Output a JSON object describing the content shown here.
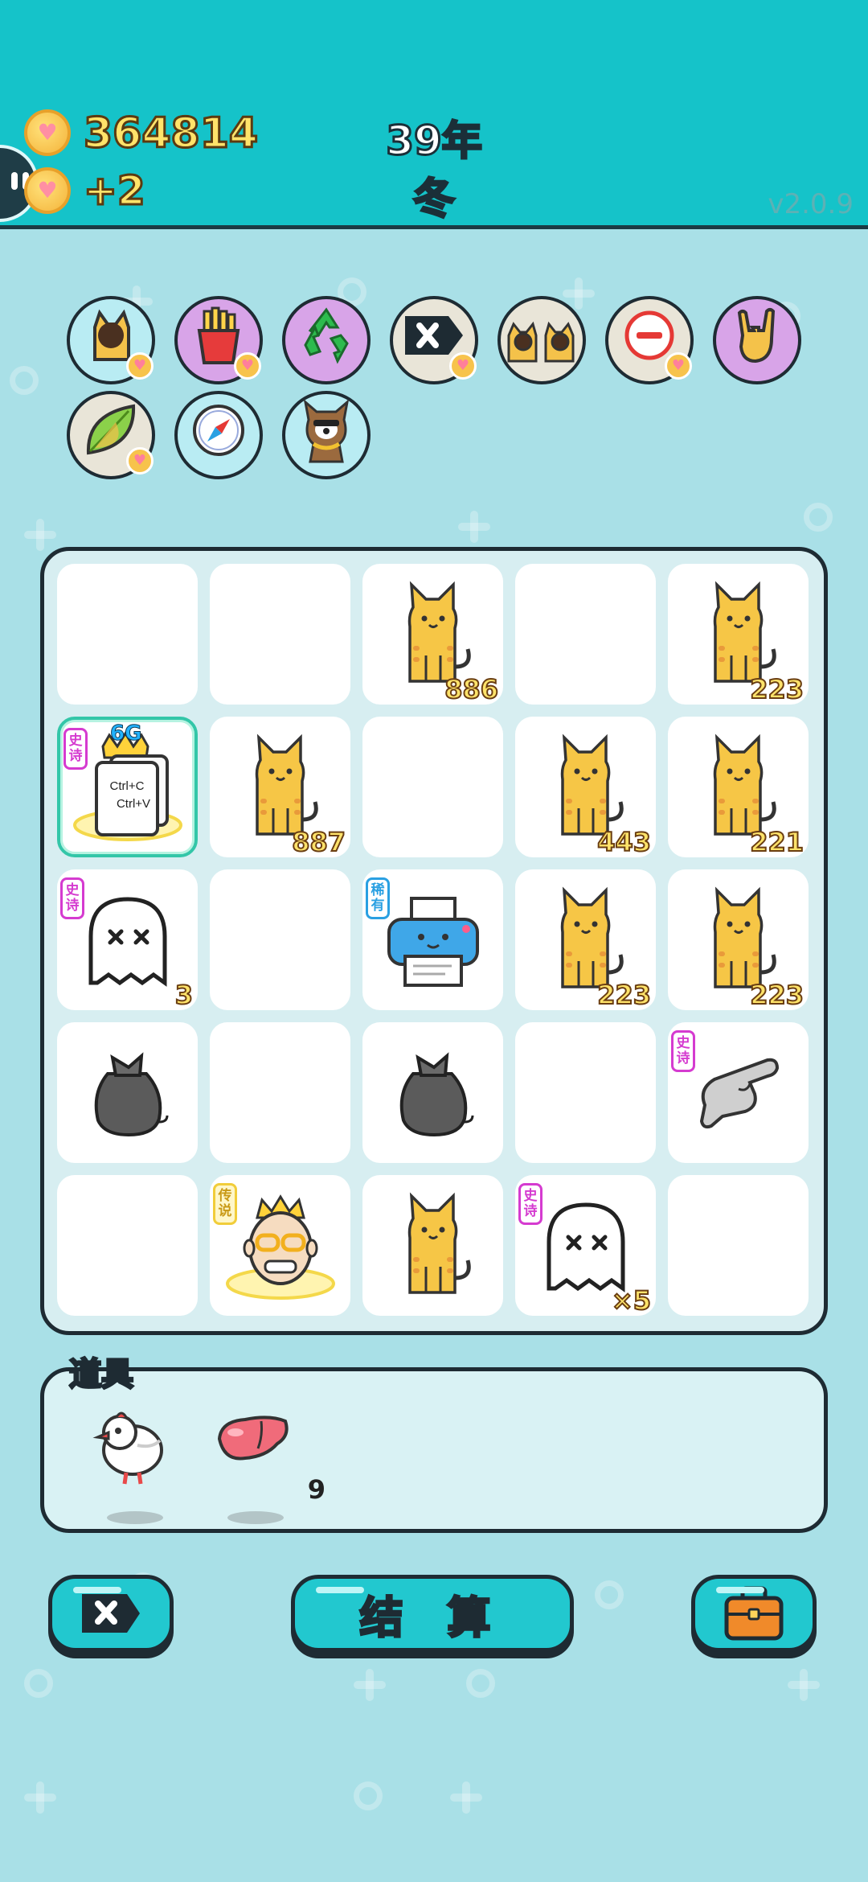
{
  "header": {
    "money": "364814",
    "income": "+2",
    "year": "39年",
    "season": "冬",
    "version": "v2.0.9"
  },
  "perks": [
    {
      "icon": "cat-silhouette-icon",
      "bg": "#b9ecf3",
      "heart": true
    },
    {
      "icon": "fries-icon",
      "bg": "#d8a4e8",
      "heart": true
    },
    {
      "icon": "recycle-icon",
      "bg": "#d8a4e8",
      "heart": false
    },
    {
      "icon": "delete-tag-icon",
      "bg": "#e9e5d8",
      "heart": true
    },
    {
      "icon": "twin-cats-icon",
      "bg": "#e9e5d8",
      "heart": false
    },
    {
      "icon": "minus-circle-icon",
      "bg": "#e9e5d8",
      "heart": true
    },
    {
      "icon": "rock-hand-icon",
      "bg": "#d8a4e8",
      "heart": false
    },
    {
      "icon": "leaf-icon",
      "bg": "#e9e5d8",
      "heart": true
    },
    {
      "icon": "compass-icon",
      "bg": "#b9ecf3",
      "heart": false
    },
    {
      "icon": "dog-with-chain-icon",
      "bg": "#b9ecf3",
      "heart": false
    }
  ],
  "board": [
    [
      {
        "type": "empty"
      },
      {
        "type": "empty"
      },
      {
        "type": "cat",
        "num": "886"
      },
      {
        "type": "empty"
      },
      {
        "type": "cat",
        "num": "223"
      }
    ],
    [
      {
        "type": "copy-paste",
        "badge": "史诗",
        "rarity": "epic",
        "extra": "6G"
      },
      {
        "type": "cat",
        "num": "887"
      },
      {
        "type": "empty"
      },
      {
        "type": "cat",
        "num": "443"
      },
      {
        "type": "cat",
        "num": "221"
      }
    ],
    [
      {
        "type": "ghost",
        "badge": "史诗",
        "rarity": "epic",
        "num": "3"
      },
      {
        "type": "empty"
      },
      {
        "type": "printer",
        "badge": "稀有",
        "rarity": "rare"
      },
      {
        "type": "cat",
        "num": "223"
      },
      {
        "type": "cat",
        "num": "223"
      }
    ],
    [
      {
        "type": "trash-bag"
      },
      {
        "type": "empty"
      },
      {
        "type": "trash-bag"
      },
      {
        "type": "empty"
      },
      {
        "type": "pointing-hand",
        "badge": "史诗",
        "rarity": "epic"
      }
    ],
    [
      {
        "type": "empty"
      },
      {
        "type": "king",
        "badge": "传说",
        "rarity": "legend"
      },
      {
        "type": "cat"
      },
      {
        "type": "ghost",
        "badge": "史诗",
        "rarity": "epic",
        "num": "×5"
      },
      {
        "type": "empty"
      }
    ]
  ],
  "items_panel": {
    "title": "道具",
    "items": [
      {
        "icon": "white-bird-icon",
        "count": ""
      },
      {
        "icon": "liver-icon",
        "count": "9"
      }
    ]
  },
  "buttons": {
    "delete_icon": "delete-tag-icon",
    "settle_label": "结 算",
    "bag_icon": "briefcase-icon"
  }
}
